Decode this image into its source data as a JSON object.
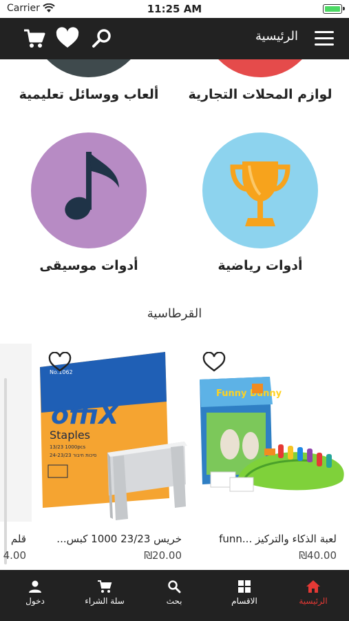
{
  "status_bar": {
    "carrier": "Carrier",
    "time": "11:25 AM"
  },
  "header": {
    "title": "الرئيسية"
  },
  "categories": [
    {
      "label": "لوازم المحلات التجارية",
      "color": "#e54b4b"
    },
    {
      "label": "ألعاب ووسائل تعليمية",
      "color": "#3f4a4d"
    },
    {
      "label": "أدوات رياضية",
      "color": "#8dd3ee",
      "icon": "trophy-icon"
    },
    {
      "label": "أدوات موسيقى",
      "color": "#b78bc4",
      "icon": "music-note-icon"
    }
  ],
  "section": {
    "title": "القرطاسية"
  },
  "products": [
    {
      "name": "لعبة الذكاء والتركيز ...funn",
      "price": "₪40.00"
    },
    {
      "name": "خريس 23/23  1000 كبس...",
      "price": "₪20.00"
    },
    {
      "name": "قلم",
      "price": "4.00"
    }
  ],
  "product_images": {
    "funny_bunny": {
      "logo": "Funny Bunny"
    },
    "offix": {
      "brand": "offiX",
      "label": "Staples",
      "sub": "24-23/23 סיכות חיבור",
      "count": "13/23 1000pcs",
      "code": "No.1062"
    }
  },
  "bottom_nav": {
    "home": "الرئيسية",
    "categories": "الاقسام",
    "search": "بحث",
    "cart": "سلة الشراء",
    "login": "دخول"
  },
  "colors": {
    "header_bg": "#222222",
    "active": "#e53935"
  }
}
